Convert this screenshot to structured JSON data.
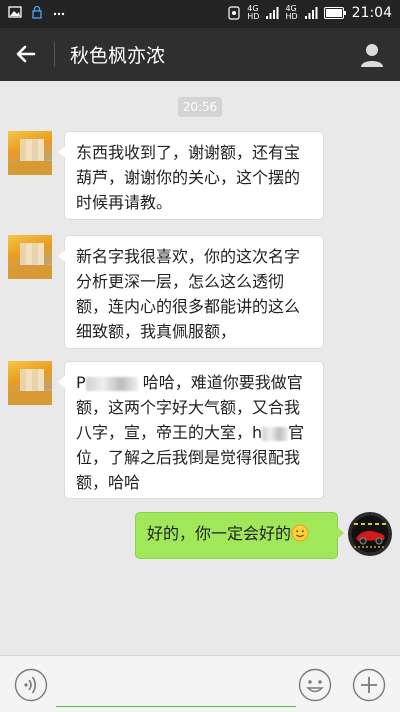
{
  "status_bar": {
    "time": "21:04",
    "network_1": "4G",
    "network_2": "4G",
    "hd_1": "HD",
    "hd_2": "HD"
  },
  "header": {
    "title": "秋色枫亦浓"
  },
  "chat": {
    "timestamp": "20:56",
    "messages": [
      {
        "side": "left",
        "text": "东西我收到了，谢谢额，还有宝葫芦，谢谢你的关心，这个摆的时候再请教。"
      },
      {
        "side": "left",
        "text": "新名字我很喜欢，你的这次名字分析更深一层，怎么这么透彻额，连内心的很多都能讲的这么细致额，我真佩服额，"
      },
      {
        "side": "left",
        "prefix": "P",
        "text_a": "哈哈，难道你要我做官额，这两个字好大气额，又合我八字，宣，帝王的大室，",
        "prefix_b": "h",
        "text_b": "官位，了解之后我倒是觉得很配我额，哈哈"
      },
      {
        "side": "right",
        "text": "好的，你一定会好的"
      }
    ]
  },
  "input_bar": {
    "value": ""
  },
  "colors": {
    "header_bg": "#2f2f2f",
    "status_bg": "#232323",
    "chat_bg": "#e9e9e9",
    "bubble_self": "#a0e75a",
    "input_underline": "#4fbf2a"
  },
  "icons": {
    "back": "arrow-left-icon",
    "profile": "person-icon",
    "voice": "voice-icon",
    "emoji": "smiley-icon",
    "plus": "plus-icon"
  }
}
